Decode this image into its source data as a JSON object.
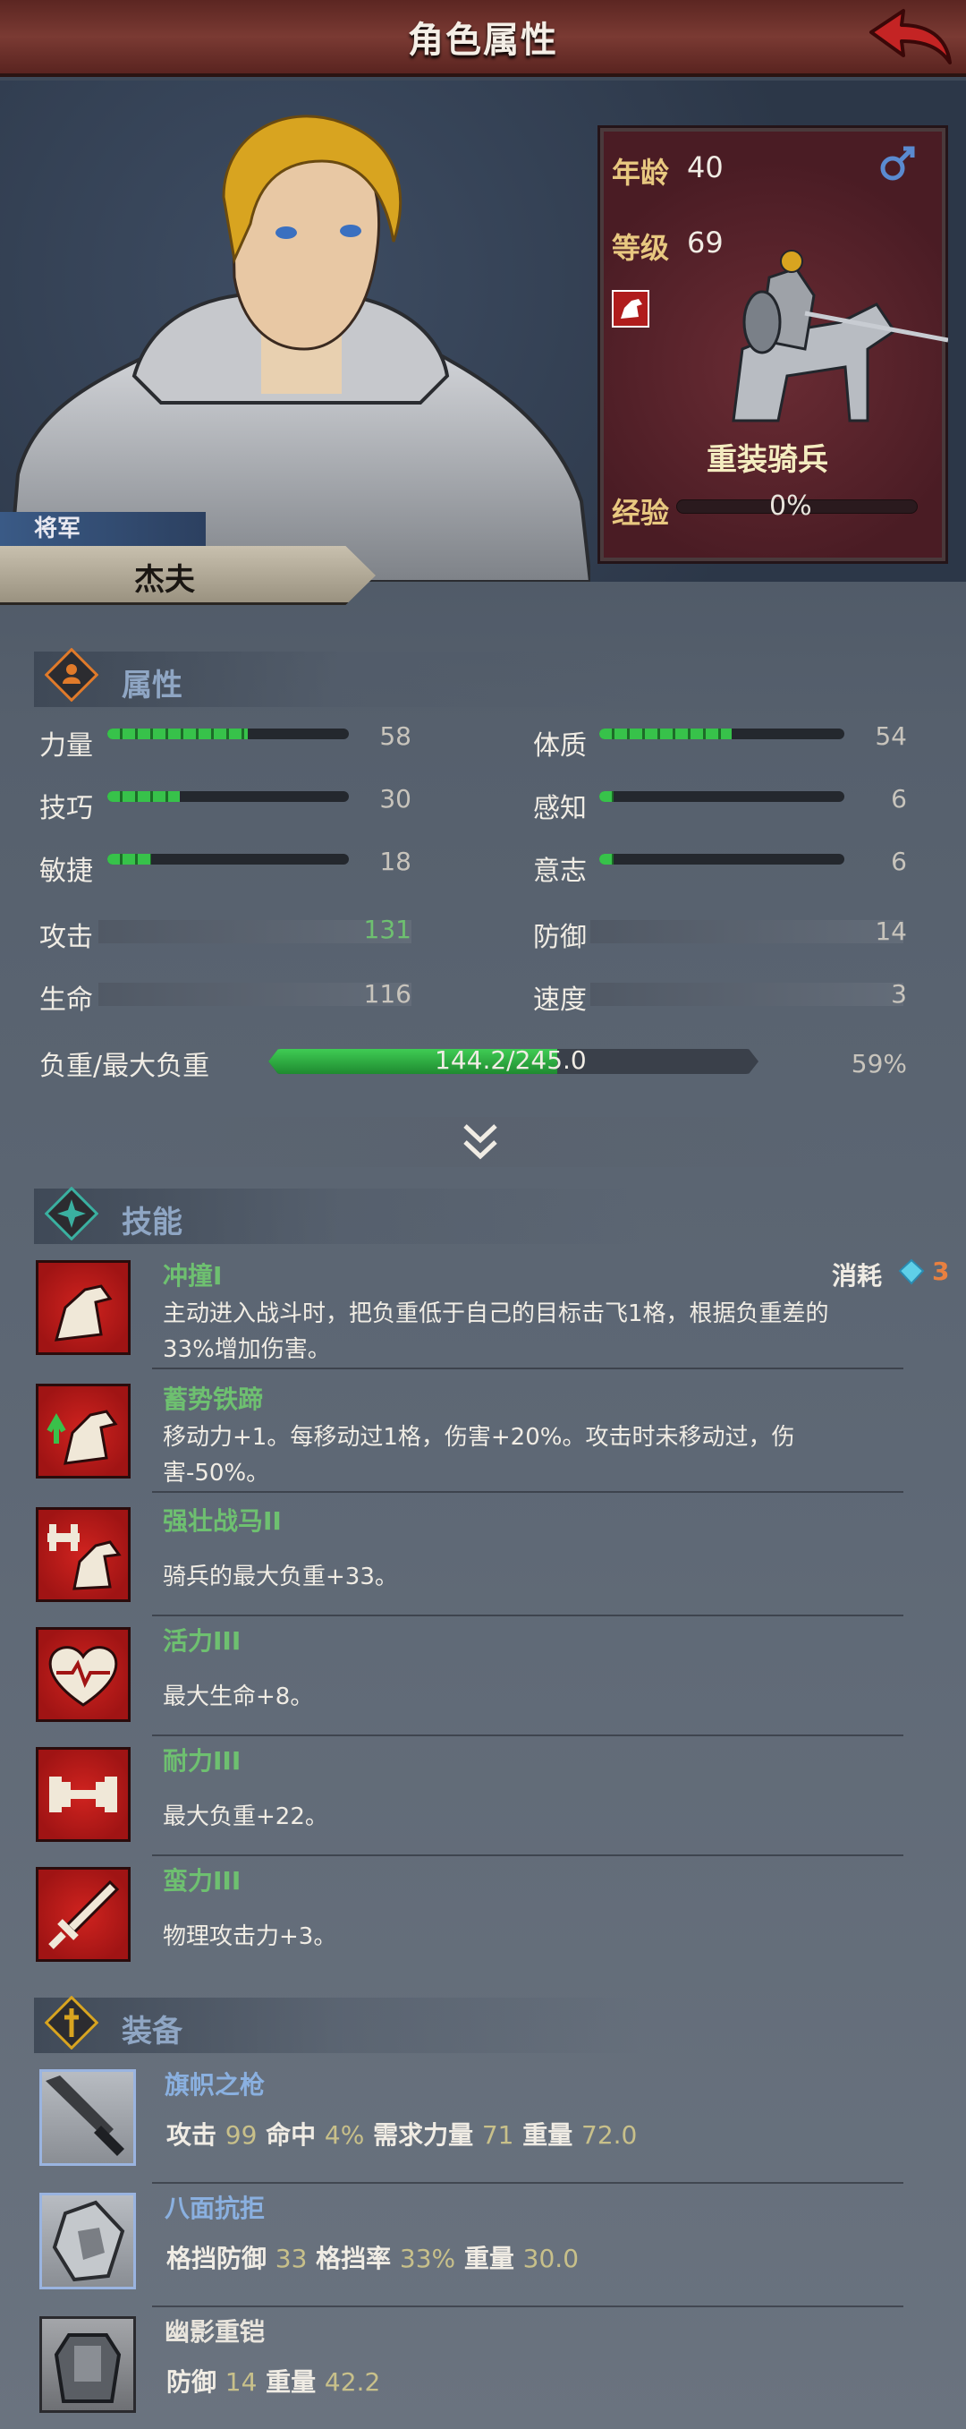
{
  "header": {
    "title": "角色属性"
  },
  "hero": {
    "rank": "将军",
    "name": "杰夫"
  },
  "unit_card": {
    "age_label": "年龄",
    "age": "40",
    "level_label": "等级",
    "level": "69",
    "gender_icon": "male-icon",
    "class_name": "重装骑兵",
    "exp_label": "经验",
    "exp_value": "0%"
  },
  "attributes": {
    "title": "属性",
    "strength": {
      "label": "力量",
      "value": "58",
      "fill": 0.58
    },
    "constitution": {
      "label": "体质",
      "value": "54",
      "fill": 0.54
    },
    "skill": {
      "label": "技巧",
      "value": "30",
      "fill": 0.3
    },
    "perception": {
      "label": "感知",
      "value": "6",
      "fill": 0.06
    },
    "agility": {
      "label": "敏捷",
      "value": "18",
      "fill": 0.18
    },
    "will": {
      "label": "意志",
      "value": "6",
      "fill": 0.06
    },
    "attack": {
      "label": "攻击",
      "value": "131"
    },
    "defense": {
      "label": "防御",
      "value": "14"
    },
    "life": {
      "label": "生命",
      "value": "116"
    },
    "speed": {
      "label": "速度",
      "value": "3"
    },
    "load": {
      "label": "负重/最大负重",
      "value": "144.2/245.0",
      "percent": "59%",
      "fill": 0.59
    }
  },
  "skills": {
    "title": "技能",
    "cost_label": "消耗",
    "cost_value": "3",
    "items": [
      {
        "name": "冲撞I",
        "desc": "主动进入战斗时，把负重低于自己的目标击飞1格，根据负重差的33%增加伤害。",
        "icon": "horse-charge-icon"
      },
      {
        "name": "蓄势铁蹄",
        "desc": "移动力+1。每移动过1格，伤害+20%。攻击时未移动过，伤害-50%。",
        "icon": "horse-boost-icon"
      },
      {
        "name": "强壮战马II",
        "desc": "骑兵的最大负重+33。",
        "icon": "horse-weight-icon"
      },
      {
        "name": "活力III",
        "desc": "最大生命+8。",
        "icon": "heart-icon"
      },
      {
        "name": "耐力III",
        "desc": "最大负重+22。",
        "icon": "dumbbell-icon"
      },
      {
        "name": "蛮力III",
        "desc": "物理攻击力+3。",
        "icon": "sword-icon"
      }
    ]
  },
  "equipment": {
    "title": "装备",
    "items": [
      {
        "name": "旗帜之枪",
        "icon": "lance-icon",
        "s1_label": "攻击",
        "s1_val": "99",
        "s2_label": "命中",
        "s2_val": "4%",
        "s3_label": "需求力量",
        "s3_val": "71",
        "s4_label": "重量",
        "s4_val": "72.0"
      },
      {
        "name": "八面抗拒",
        "icon": "shield-icon",
        "s1_label": "格挡防御",
        "s1_val": "33",
        "s2_label": "格挡率",
        "s2_val": "33%",
        "s3_label": "重量",
        "s3_val": "30.0"
      },
      {
        "name": "幽影重铠",
        "icon": "armor-icon",
        "s1_label": "防御",
        "s1_val": "14",
        "s2_label": "重量",
        "s2_val": "42.2"
      }
    ]
  }
}
